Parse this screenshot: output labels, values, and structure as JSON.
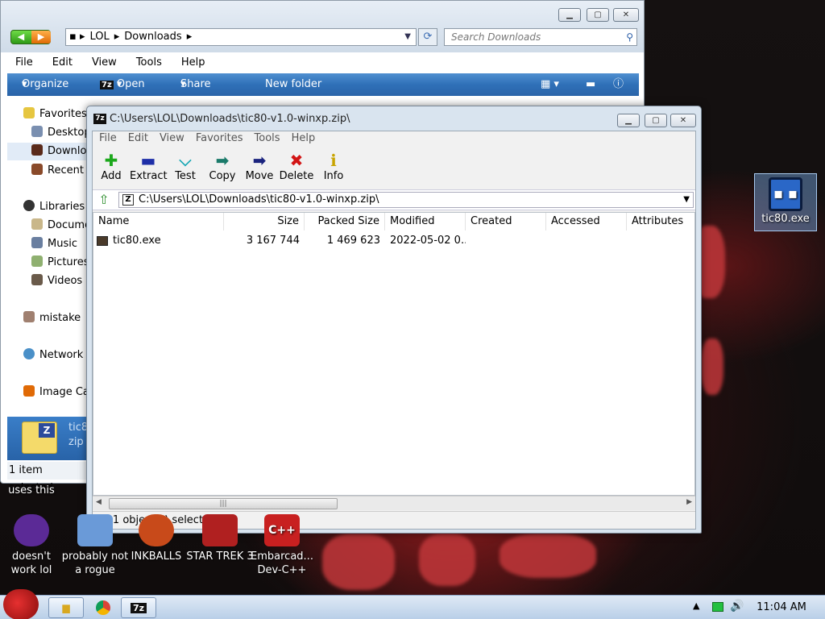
{
  "explorer": {
    "breadcrumb": [
      "LOL",
      "Downloads"
    ],
    "search_placeholder": "Search Downloads",
    "menu": [
      "File",
      "Edit",
      "View",
      "Tools",
      "Help"
    ],
    "commands": {
      "organize": "Organize",
      "open": "Open",
      "share": "Share with",
      "new_folder": "New folder"
    },
    "nav": [
      {
        "label": "Favorites",
        "icon": "star-icon"
      },
      {
        "label": "Desktop",
        "icon": "desktop-icon"
      },
      {
        "label": "Downloads",
        "icon": "downloads-icon",
        "selected": true
      },
      {
        "label": "Recent Places",
        "icon": "recent-places-icon"
      },
      {
        "label": "Libraries",
        "icon": "libraries-icon"
      },
      {
        "label": "Documents",
        "icon": "documents-icon"
      },
      {
        "label": "Music",
        "icon": "music-icon"
      },
      {
        "label": "Pictures",
        "icon": "pictures-icon"
      },
      {
        "label": "Videos",
        "icon": "videos-icon"
      },
      {
        "label": "mistake",
        "icon": "homegroup-icon"
      },
      {
        "label": "Network",
        "icon": "network-icon"
      },
      {
        "label": "Image Catalog",
        "icon": "image-catalog-icon"
      }
    ],
    "details": {
      "name": "tic80",
      "type": "zip"
    },
    "status": "1 item selected"
  },
  "sevenzip": {
    "title": "C:\\Users\\LOL\\Downloads\\tic80-v1.0-winxp.zip\\",
    "menu": [
      "File",
      "Edit",
      "View",
      "Favorites",
      "Tools",
      "Help"
    ],
    "toolbar": [
      {
        "label": "Add",
        "icon": "add-icon",
        "glyph": "✚",
        "color": "#1ca81c"
      },
      {
        "label": "Extract",
        "icon": "extract-icon",
        "glyph": "▬",
        "color": "#1e2fa8"
      },
      {
        "label": "Test",
        "icon": "test-icon",
        "glyph": "⌵",
        "color": "#16a6b4"
      },
      {
        "label": "Copy",
        "icon": "copy-icon",
        "glyph": "➡",
        "color": "#1a7a6a"
      },
      {
        "label": "Move",
        "icon": "move-icon",
        "glyph": "➡",
        "color": "#1a237e"
      },
      {
        "label": "Delete",
        "icon": "delete-icon",
        "glyph": "✖",
        "color": "#d21414"
      },
      {
        "label": "Info",
        "icon": "info-icon",
        "glyph": "ℹ",
        "color": "#c8a400"
      }
    ],
    "path": "C:\\Users\\LOL\\Downloads\\tic80-v1.0-winxp.zip\\",
    "columns": [
      "Name",
      "Size",
      "Packed Size",
      "Modified",
      "Created",
      "Accessed",
      "Attributes"
    ],
    "rows": [
      {
        "name": "tic80.exe",
        "size": "3 167 744",
        "packed": "1 469 623",
        "modified": "2022-05-02 0...",
        "created": "",
        "accessed": "",
        "attributes": ""
      }
    ],
    "status": "0 / 1 object(s) selected"
  },
  "desktop": {
    "tic_icon": "tic80.exe",
    "uses_this": "uses this",
    "icons": [
      {
        "label": "doesn't work lol",
        "icon": "yahoo-messenger-icon"
      },
      {
        "label": "probably not a rogue",
        "icon": "shortcut-icon"
      },
      {
        "label": "INKBALLS",
        "icon": "inkballs-icon"
      },
      {
        "label": "STAR TREK 3",
        "icon": "star-trek-icon"
      },
      {
        "label": "Embarcad... Dev-C++",
        "icon": "devcpp-icon"
      }
    ]
  },
  "taskbar": {
    "clock": "11:04 AM"
  }
}
